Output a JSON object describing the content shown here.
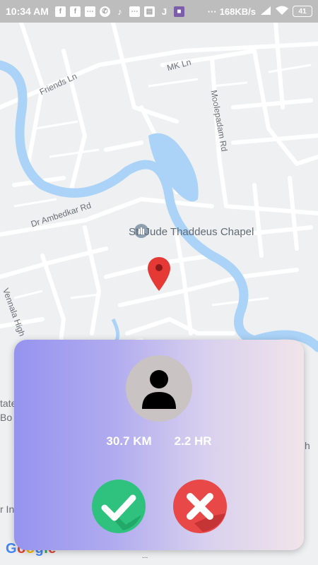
{
  "status_bar": {
    "time": "10:34 AM",
    "speed": "168KB/s",
    "battery": "41",
    "notification_icons": [
      "facebook-icon",
      "facebook-icon",
      "message-icon",
      "whatsapp-icon",
      "tiktok-icon",
      "message-icon",
      "news-icon",
      "jio-icon",
      "app-icon"
    ],
    "more": "···"
  },
  "map": {
    "streets": {
      "friends_ln": "Friends Ln",
      "mk_ln": "MK Ln",
      "moolepadam_rd": "Moolepadam Rd",
      "dr_ambedkar_rd": "Dr Ambedkar Rd",
      "vennala_high": "Vennala High"
    },
    "poi": "St. Jude Thaddeus Chapel",
    "edge_fragments": {
      "left_1": "tate",
      "left_2": "Bo",
      "left_3": "r Inc",
      "right_1": "h"
    },
    "google_logo": "Google",
    "colors": {
      "water": "#aad3f7",
      "road": "#ffffff",
      "land": "#eef0f2",
      "pin": "#e53935"
    }
  },
  "card": {
    "distance": "30.7 KM",
    "duration": "2.2 HR",
    "accept_icon": "checkmark-icon",
    "reject_icon": "cross-icon",
    "colors": {
      "accept": "#2ec27e",
      "reject": "#e94848",
      "gradient_start": "#9693ef",
      "gradient_end": "#f1e4ea"
    }
  },
  "bottom_hint": "..."
}
